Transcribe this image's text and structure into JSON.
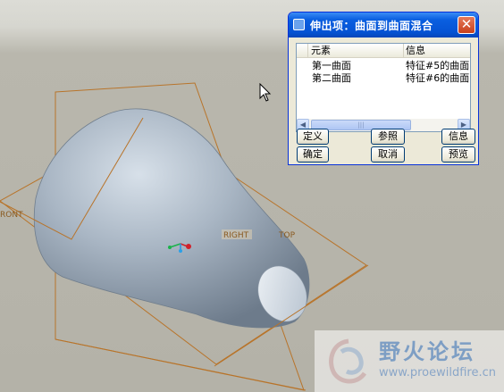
{
  "viewport": {
    "plane_labels": {
      "front": "RONT",
      "right": "RIGHT",
      "top": "TOP"
    }
  },
  "dialog": {
    "title": "伸出项：曲面到曲面混合",
    "close_icon": "close-icon",
    "columns": [
      "元素",
      "信息"
    ],
    "rows": [
      {
        "element": "第一曲面",
        "info": "特征#5的曲面"
      },
      {
        "element": "第二曲面",
        "info": "特征#6的曲面"
      }
    ],
    "buttons": {
      "define": "定义",
      "refs": "参照",
      "info": "信息",
      "ok": "确定",
      "cancel": "取消",
      "preview": "预览"
    }
  },
  "watermark": {
    "name": "野火论坛",
    "url": "www.proewildfire.cn"
  },
  "colors": {
    "datum_plane": "#b8742a",
    "surface": "#a9b6c4",
    "titlebar": "#0553d4"
  }
}
